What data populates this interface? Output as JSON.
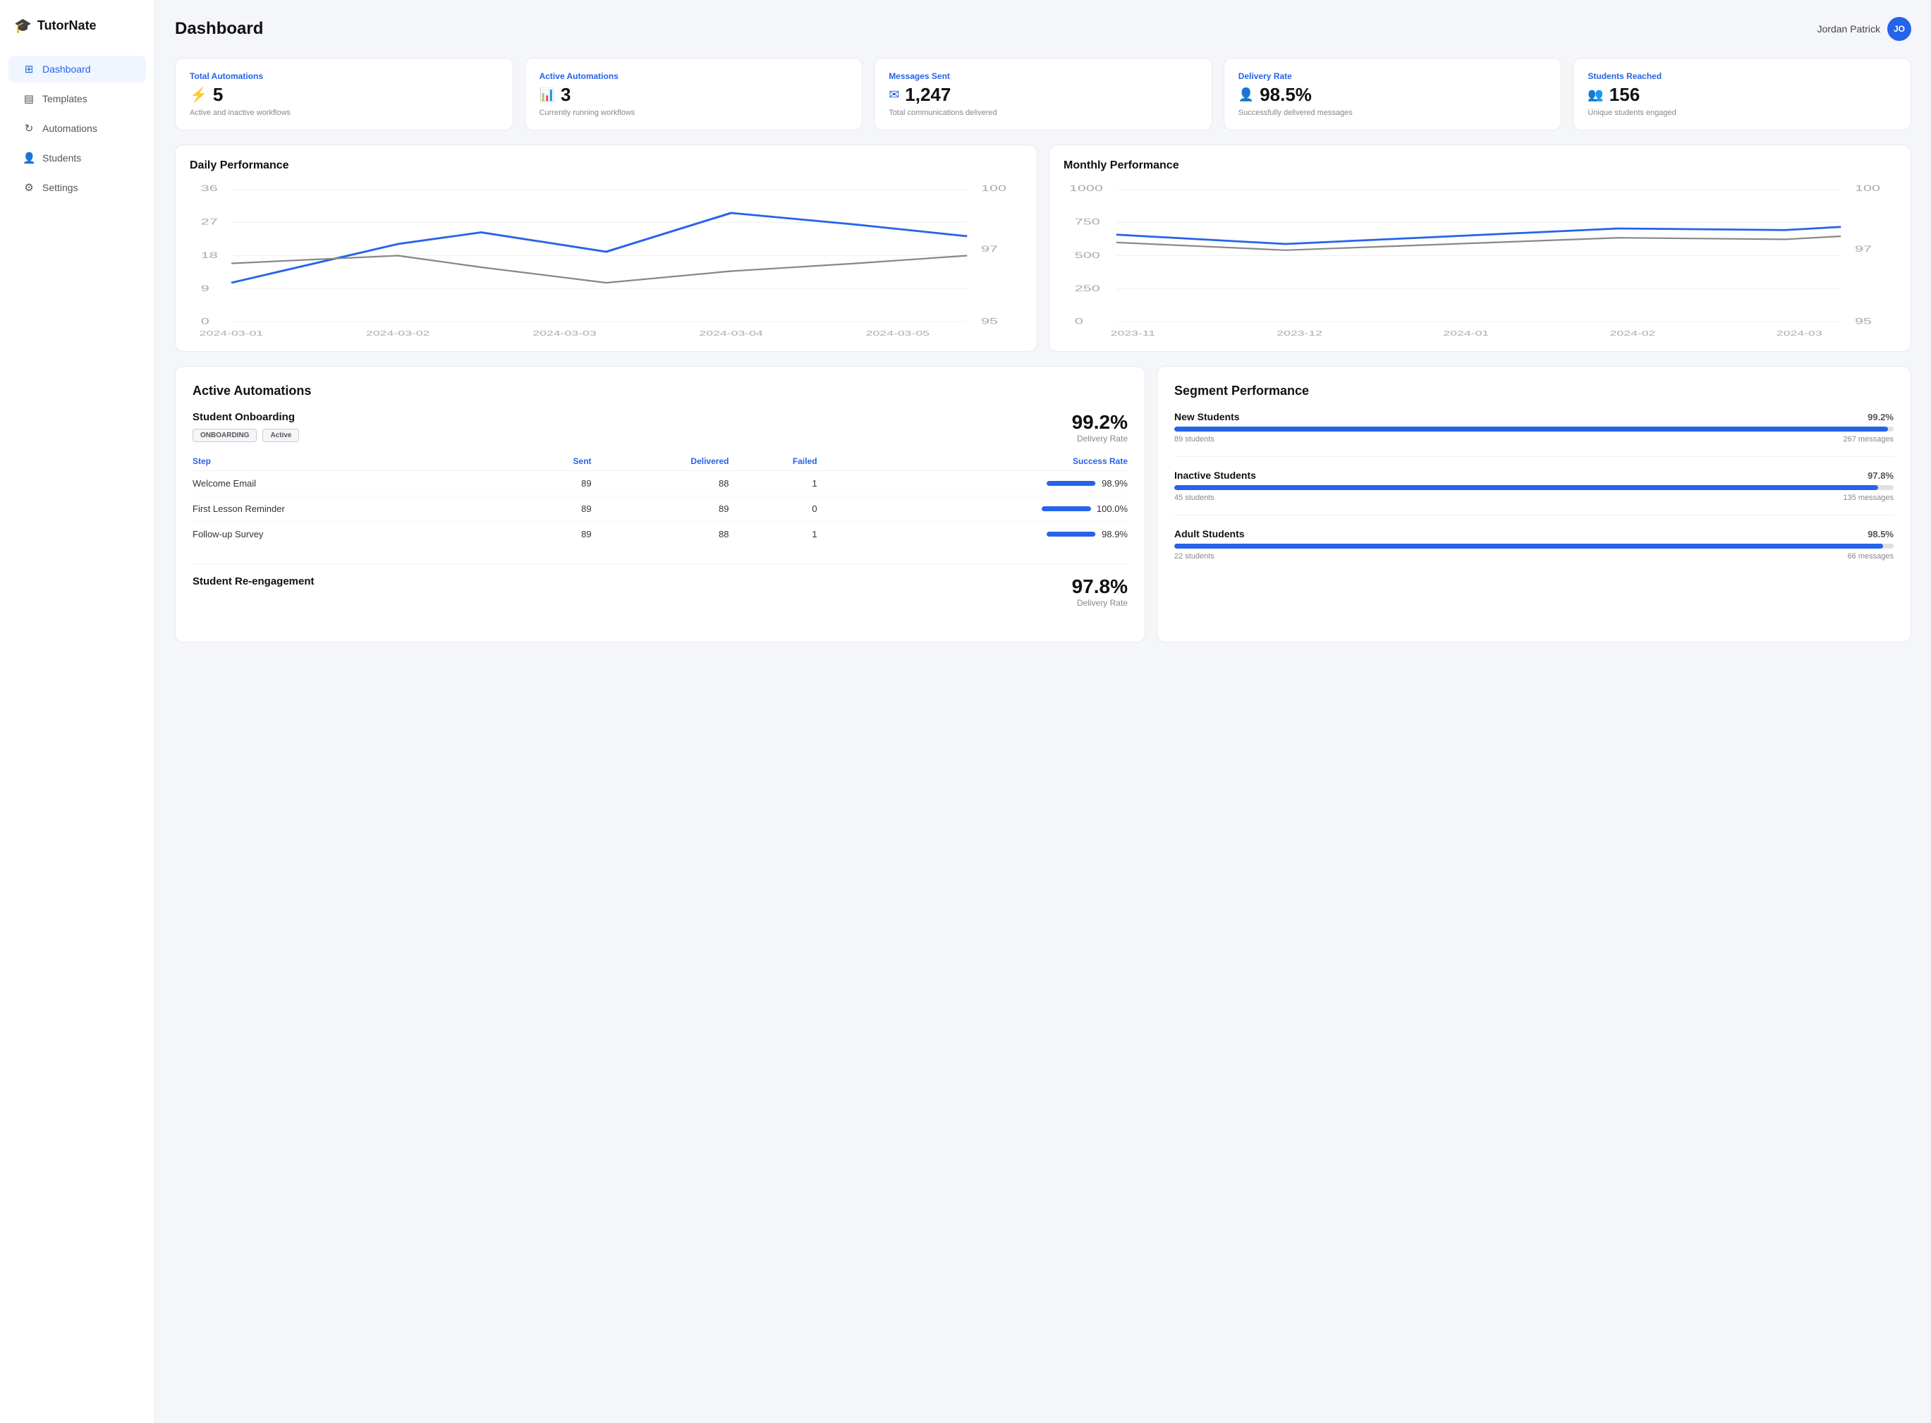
{
  "app": {
    "name": "TutorNate"
  },
  "user": {
    "name": "Jordan Patrick",
    "initials": "JO"
  },
  "sidebar": {
    "items": [
      {
        "id": "dashboard",
        "label": "Dashboard",
        "icon": "⊞",
        "active": true
      },
      {
        "id": "templates",
        "label": "Templates",
        "icon": "▤",
        "active": false
      },
      {
        "id": "automations",
        "label": "Automations",
        "icon": "↻",
        "active": false
      },
      {
        "id": "students",
        "label": "Students",
        "icon": "👤",
        "active": false
      },
      {
        "id": "settings",
        "label": "Settings",
        "icon": "⚙",
        "active": false
      }
    ]
  },
  "page": {
    "title": "Dashboard"
  },
  "stats": [
    {
      "label": "Total Automations",
      "value": "5",
      "desc": "Active and inactive workflows",
      "icon": "⚡"
    },
    {
      "label": "Active Automations",
      "value": "3",
      "desc": "Currently running workflows",
      "icon": "📊"
    },
    {
      "label": "Messages Sent",
      "value": "1,247",
      "desc": "Total communications delivered",
      "icon": "✉"
    },
    {
      "label": "Delivery Rate",
      "value": "98.5%",
      "desc": "Successfully delivered messages",
      "icon": "👤"
    },
    {
      "label": "Students Reached",
      "value": "156",
      "desc": "Unique students engaged",
      "icon": "👥"
    }
  ],
  "daily_chart": {
    "title": "Daily Performance",
    "y_labels": [
      "36",
      "27",
      "18",
      "9",
      "0"
    ],
    "y_labels_right": [
      "100",
      "97",
      "95"
    ],
    "x_labels": [
      "2024-03-01",
      "2024-03-02",
      "2024-03-03",
      "2024-03-04",
      "2024-03-05"
    ]
  },
  "monthly_chart": {
    "title": "Monthly Performance",
    "y_labels": [
      "1000",
      "750",
      "500",
      "250",
      "0"
    ],
    "y_labels_right": [
      "100",
      "97",
      "95"
    ],
    "x_labels": [
      "2023-11",
      "2023-12",
      "2024-01",
      "2024-02",
      "2024-03"
    ]
  },
  "active_automations": {
    "title": "Active Automations",
    "blocks": [
      {
        "name": "Student Onboarding",
        "badges": [
          "ONBOARDING",
          "Active"
        ],
        "delivery_rate": "99.2%",
        "delivery_label": "Delivery Rate",
        "steps": [
          {
            "step": "Welcome Email",
            "sent": "89",
            "delivered": "88",
            "failed": "1",
            "success": "98.9%",
            "bar": 98.9
          },
          {
            "step": "First Lesson Reminder",
            "sent": "89",
            "delivered": "89",
            "failed": "0",
            "success": "100.0%",
            "bar": 100
          },
          {
            "step": "Follow-up Survey",
            "sent": "89",
            "delivered": "88",
            "failed": "1",
            "success": "98.9%",
            "bar": 98.9
          }
        ],
        "cols": [
          "Step",
          "Sent",
          "Delivered",
          "Failed",
          "Success Rate"
        ]
      },
      {
        "name": "Student Re-engagement",
        "delivery_rate": "97.8%",
        "delivery_label": "Delivery Rate",
        "badges": [],
        "steps": []
      }
    ]
  },
  "segment_performance": {
    "title": "Segment Performance",
    "segments": [
      {
        "name": "New Students",
        "pct": "99.2%",
        "bar": 99.2,
        "students": "89 students",
        "messages": "267 messages"
      },
      {
        "name": "Inactive Students",
        "pct": "97.8%",
        "bar": 97.8,
        "students": "45 students",
        "messages": "135 messages"
      },
      {
        "name": "Adult Students",
        "pct": "98.5%",
        "bar": 98.5,
        "students": "22 students",
        "messages": "66 messages"
      }
    ]
  }
}
